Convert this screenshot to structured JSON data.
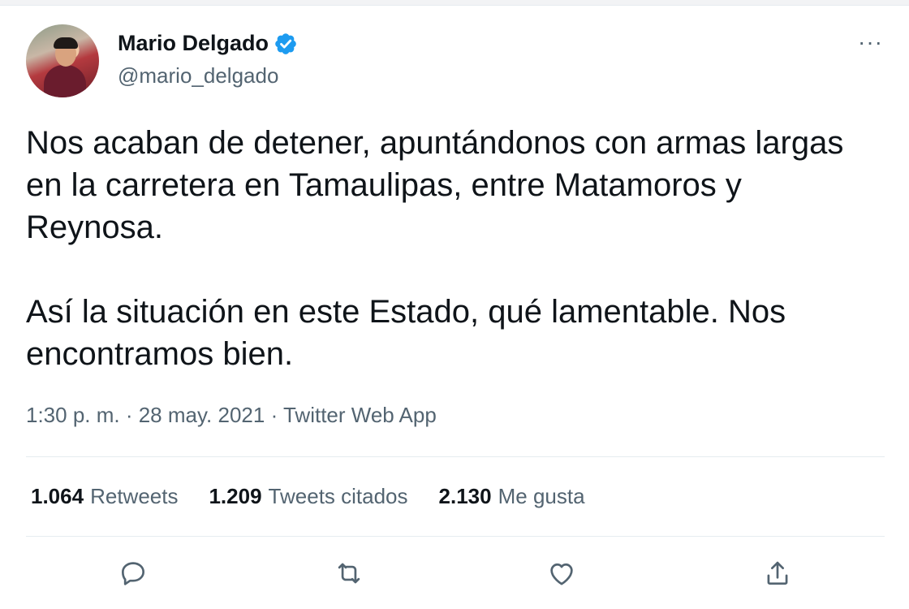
{
  "user": {
    "name": "Mario Delgado",
    "handle": "@mario_delgado",
    "verified": true
  },
  "tweet": {
    "paragraphs": [
      "Nos acaban de detener, apuntándonos con armas largas en la carretera en Tamaulipas, entre Matamoros y Reynosa.",
      "Así la situación en este Estado, qué lamentable. Nos encontramos bien."
    ],
    "timestamp": "1:30 p. m. · 28 may. 2021 · Twitter Web App"
  },
  "stats": [
    {
      "count": "1.064",
      "label": "Retweets"
    },
    {
      "count": "1.209",
      "label": "Tweets citados"
    },
    {
      "count": "2.130",
      "label": "Me gusta"
    }
  ],
  "actions": [
    "reply-icon",
    "retweet-icon",
    "like-icon",
    "share-icon"
  ],
  "more_label": "···",
  "colors": {
    "accent": "#1d9bf0",
    "secondary_text": "#536471",
    "primary_text": "#0f1419",
    "divider": "#e6ecf0"
  }
}
